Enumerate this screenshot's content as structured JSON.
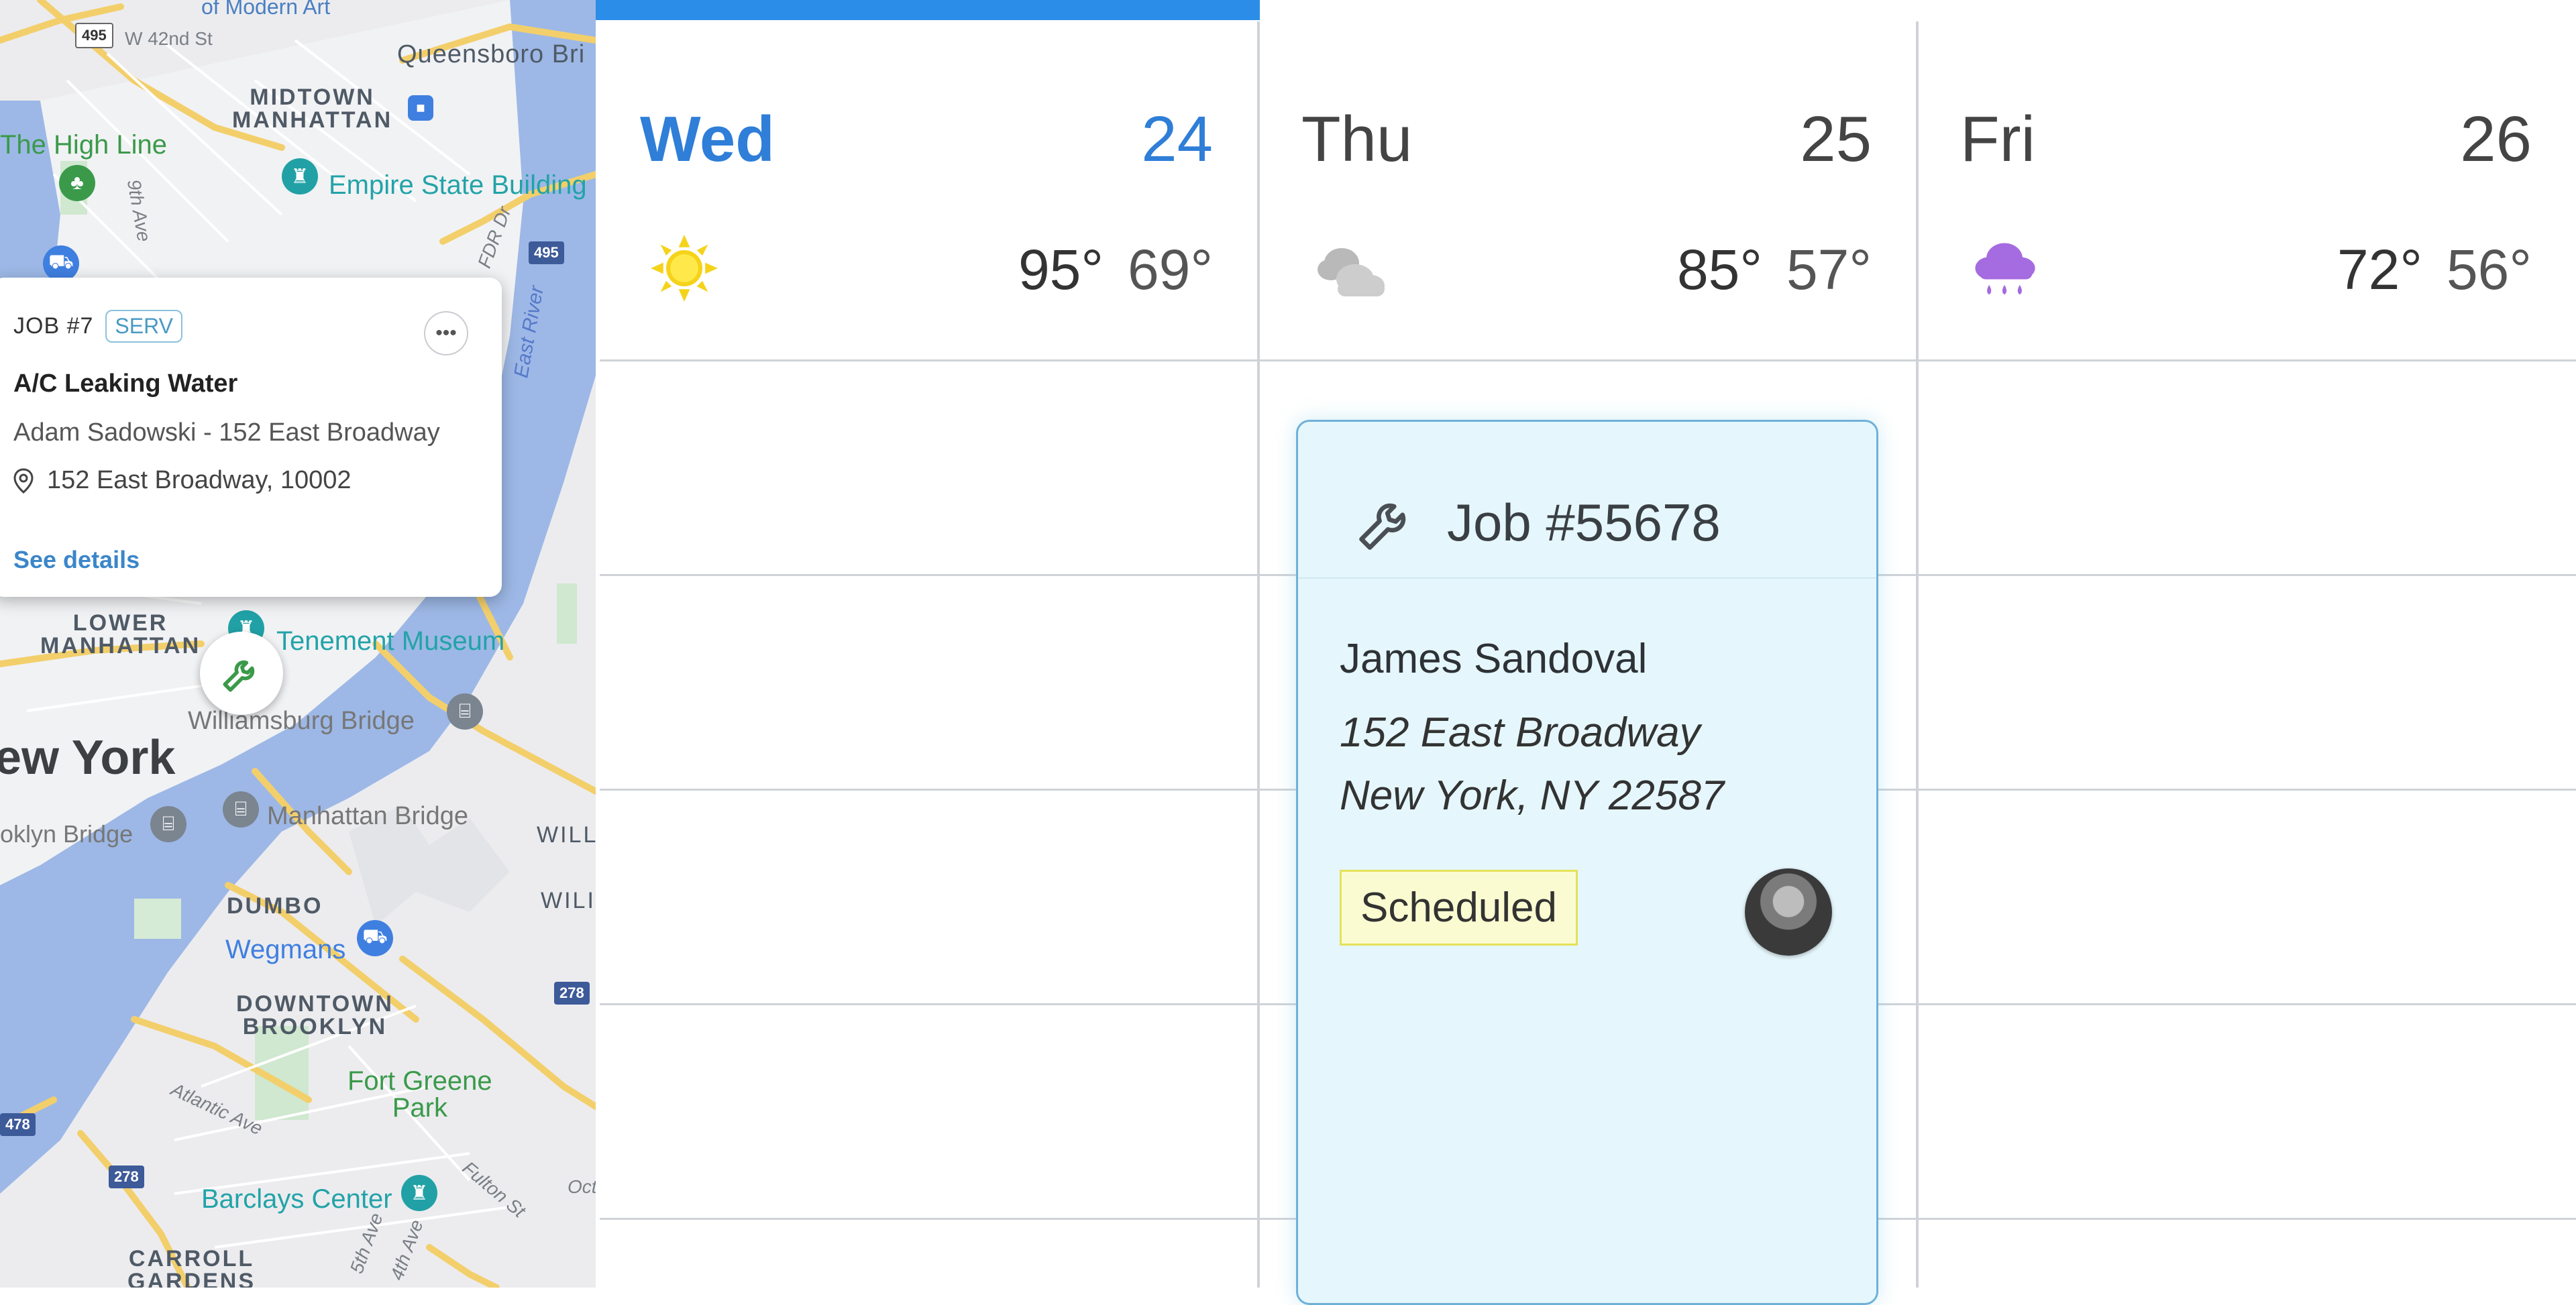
{
  "map": {
    "labels": {
      "museum": "of Modern Art",
      "w42": "W 42nd St",
      "queensboro": "Queensboro Bri",
      "midtown": "MIDTOWN\nMANHATTAN",
      "highline": "The High Line",
      "empire": "Empire State Building",
      "ave9": "9th Ave",
      "fdr": "FDR Dr",
      "eastriver": "East River",
      "lower": "LOWER\nMANHATTAN",
      "tenement": "Tenement Museum",
      "williamsburg": "Williamsburg Bridge",
      "newyork": "ew York",
      "brooklynbridge": "oklyn Bridge",
      "manhattanbridge": "Manhattan Bridge",
      "will": "WILL",
      "wili": "WILI",
      "dumbo": "DUMBO",
      "wegmans": "Wegmans",
      "downtown": "DOWNTOWN\nBROOKLYN",
      "fortgreene": "Fort Greene\nPark",
      "atlantic": "Atlantic Ave",
      "barclays": "Barclays Center",
      "fulton": "Fulton St",
      "carroll": "CARROLL\nGARDENS",
      "ave5": "5th Ave",
      "ave4": "4th Ave",
      "oct": "Oct"
    },
    "shields": {
      "s495": "495",
      "s495b": "495",
      "s278a": "278",
      "s278b": "278",
      "s478": "478"
    },
    "popup": {
      "job_number": "JOB #7",
      "badge": "SERV",
      "title": "A/C Leaking Water",
      "client_line": "Adam Sadowski - 152 East Broadway",
      "address": "152 East Broadway, 10002",
      "link": "See details",
      "more_glyph": "•••"
    }
  },
  "calendar": {
    "days": [
      {
        "name": "Wed",
        "number": "24",
        "high": "95°",
        "low": "69°",
        "weather": "sunny"
      },
      {
        "name": "Thu",
        "number": "25",
        "high": "85°",
        "low": "57°",
        "weather": "cloudy"
      },
      {
        "name": "Fri",
        "number": "26",
        "high": "72°",
        "low": "56°",
        "weather": "rain"
      }
    ],
    "job": {
      "title": "Job #55678",
      "name": "James Sandoval",
      "address_line1": "152 East Broadway",
      "address_line2": "New York, NY 22587",
      "status": "Scheduled"
    }
  },
  "colors": {
    "accent": "#2b8de8",
    "today_text": "#2f7ed8",
    "card_bg": "#e5f7fc",
    "status_bg": "#fbfbd2"
  }
}
